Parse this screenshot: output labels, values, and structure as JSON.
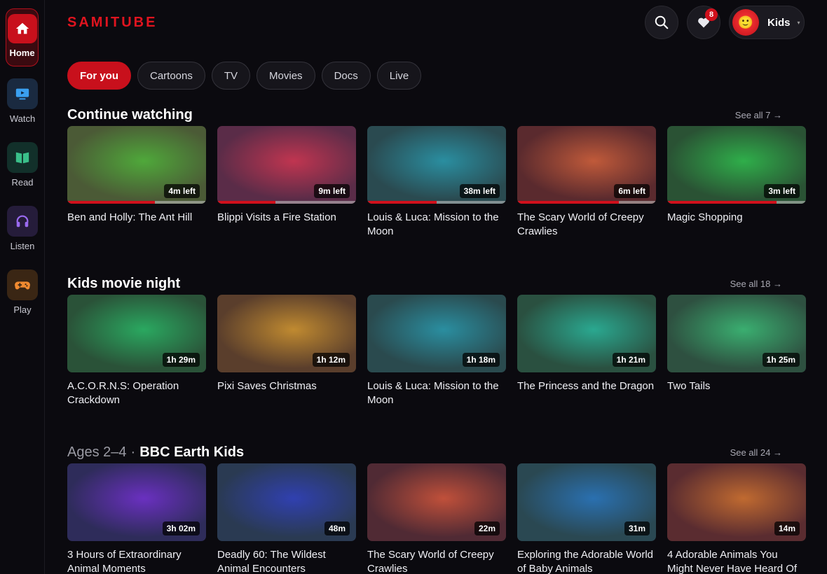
{
  "app": {
    "logo": "SAMITUBE"
  },
  "sidebar": {
    "items": [
      {
        "label": "Home",
        "icon": "home-icon",
        "color": "#c8101c"
      },
      {
        "label": "Watch",
        "icon": "tv-icon",
        "color": "#1a2a40"
      },
      {
        "label": "Read",
        "icon": "book-icon",
        "color": "#12302a"
      },
      {
        "label": "Listen",
        "icon": "headphones-icon",
        "color": "#251c3a"
      },
      {
        "label": "Play",
        "icon": "gamepad-icon",
        "color": "#3a2614"
      }
    ]
  },
  "header": {
    "search_icon": "search-icon",
    "favorites_count": "8",
    "profile_name": "Kids",
    "profile_emoji": "🙂",
    "caret": "▾"
  },
  "tabs": [
    "For you",
    "Cartoons",
    "TV",
    "Movies",
    "Docs",
    "Live"
  ],
  "sections": [
    {
      "title": "Continue watching",
      "prefix": "",
      "see_all": "See all 7 →",
      "cards": [
        {
          "title": "Ben and Holly: The Ant Hill",
          "badge": "4m left",
          "progress": 0.63,
          "c1": "#4fa83a",
          "c2": "#4b5a36"
        },
        {
          "title": "Blippi Visits a Fire Station",
          "badge": "9m left",
          "progress": 0.42,
          "c1": "#c03550",
          "c2": "#5a2c48"
        },
        {
          "title": "Louis & Luca: Mission to the Moon",
          "badge": "38m left",
          "progress": 0.5,
          "c1": "#2a8ea0",
          "c2": "#2a4a50"
        },
        {
          "title": "The Scary World of Creepy Crawlies",
          "badge": "6m left",
          "progress": 0.73,
          "c1": "#c05a3a",
          "c2": "#5a2a2e"
        },
        {
          "title": "Magic Shopping",
          "badge": "3m left",
          "progress": 0.79,
          "c1": "#2fae4a",
          "c2": "#2a5234"
        }
      ]
    },
    {
      "title": "Kids movie night",
      "prefix": "",
      "see_all": "See all 18 →",
      "cards": [
        {
          "title": "A.C.O.R.N.S: Operation Crackdown",
          "badge": "1h 29m",
          "progress": null,
          "c1": "#2aa860",
          "c2": "#2a5238"
        },
        {
          "title": "Pixi Saves Christmas",
          "badge": "1h 12m",
          "progress": null,
          "c1": "#c08a30",
          "c2": "#5a3e2c"
        },
        {
          "title": "Louis & Luca: Mission to the Moon",
          "badge": "1h 18m",
          "progress": null,
          "c1": "#2a8ea0",
          "c2": "#2a4a4e"
        },
        {
          "title": "The Princess and the Dragon",
          "badge": "1h 21m",
          "progress": null,
          "c1": "#2aa890",
          "c2": "#2a5040"
        },
        {
          "title": "Two Tails",
          "badge": "1h 25m",
          "progress": null,
          "c1": "#3aae70",
          "c2": "#2e5040"
        }
      ]
    },
    {
      "title": "BBC Earth Kids",
      "prefix": "Ages 2–4",
      "see_all": "See all 24 →",
      "cards": [
        {
          "title": "3 Hours of Extraordinary Animal Moments",
          "badge": "3h 02m",
          "progress": null,
          "c1": "#6a30c0",
          "c2": "#2e2c5a"
        },
        {
          "title": "Deadly 60: The Wildest Animal Encounters",
          "badge": "48m",
          "progress": null,
          "c1": "#3040b0",
          "c2": "#2a3a52"
        },
        {
          "title": "The Scary World of Creepy Crawlies",
          "badge": "22m",
          "progress": null,
          "c1": "#c0503a",
          "c2": "#502a34"
        },
        {
          "title": "Exploring the Adorable World of Baby Animals",
          "badge": "31m",
          "progress": null,
          "c1": "#2a70b0",
          "c2": "#2a4852"
        },
        {
          "title": "4 Adorable Animals You Might Never Have Heard Of",
          "badge": "14m",
          "progress": null,
          "c1": "#c06a30",
          "c2": "#5a2c30"
        }
      ]
    }
  ]
}
